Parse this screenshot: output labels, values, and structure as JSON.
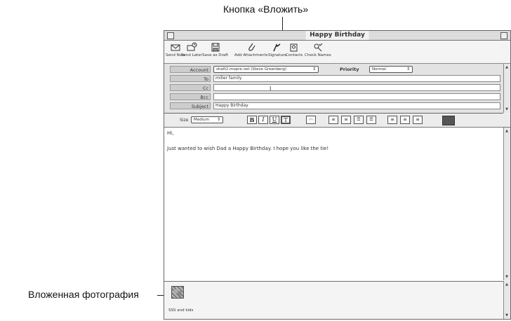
{
  "annotations": {
    "attach_button": "Кнопка «Вложить»",
    "attached_photo": "Вложенная фотография"
  },
  "window": {
    "title": "Happy Birthday"
  },
  "toolbar": {
    "send_now": "Send Now",
    "send_later": "Send Later",
    "save_as_draft": "Save as Draft",
    "add_attachments": "Add Attachments",
    "signature": "Signature",
    "contacts": "Contacts",
    "check_names": "Check Names"
  },
  "header": {
    "account_label": "Account",
    "account_value": "shaft2.mopre.net (Steve Greenberg)",
    "priority_label": "Priority",
    "priority_value": "Normal",
    "to_label": "To",
    "to_value": "miller family",
    "cc_label": "Cc",
    "cc_value": "",
    "bcc_label": "Bcc",
    "bcc_value": "",
    "subject_label": "Subject",
    "subject_value": "Happy Birthday"
  },
  "format": {
    "size_label": "Size",
    "size_value": "Medium",
    "bold": "B",
    "italic": "I",
    "underline": "U",
    "text": "T"
  },
  "body": {
    "line1": "Hi,",
    "line2": "Just wanted to wish Dad a Happy Birthday. I hope you like the tie!"
  },
  "attachment": {
    "name": "SSS and kids"
  }
}
